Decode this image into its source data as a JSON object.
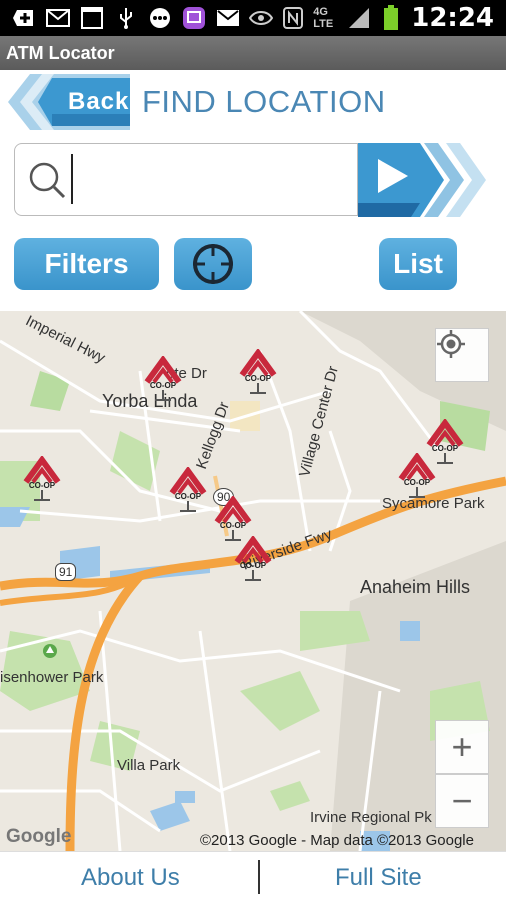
{
  "status_bar": {
    "icons": [
      "add-icon",
      "mail-icon",
      "calendar-icon",
      "usb-icon",
      "more-icon",
      "twitch-icon",
      "gmail-icon",
      "eye-icon",
      "nfc-icon",
      "network-4g-lte-icon",
      "signal-icon",
      "battery-icon"
    ],
    "calendar_day": "1",
    "network": "4G LTE",
    "time": "12:24"
  },
  "app": {
    "title": "ATM Locator"
  },
  "header": {
    "back_label": "Back",
    "title": "FIND LOCATION"
  },
  "search": {
    "value": "",
    "placeholder": ""
  },
  "buttons": {
    "filters": "Filters",
    "list": "List"
  },
  "map": {
    "labels": {
      "imperial_hwy": "Imperial Hwy",
      "yorba_linda": "Yorba Linda",
      "ote_dr": "ote Dr",
      "kellogg_dr": "Kellogg Dr",
      "village_center_dr": "Village Center Dr",
      "route_90": "90",
      "riverside_fwy": "Riverside Fwy",
      "sycamore_park": "Sycamore Park",
      "anaheim_hills": "Anaheim Hills",
      "route_91": "91",
      "eisenhower_park": "isenhower Park",
      "villa_park": "Villa Park",
      "irvine_regional": "Irvine Regional Pk",
      "google": "Google",
      "attribution": "©2013 Google - Map data ©2013 Google"
    },
    "atm_badge": "CO-OP",
    "zoom_in": "+",
    "zoom_out": "−"
  },
  "footer": {
    "about": "About Us",
    "full_site": "Full Site"
  },
  "colors": {
    "accent": "#3a94cb",
    "title": "#4a87b4",
    "freeway": "#f4a341",
    "atm_red": "#c8283c"
  }
}
